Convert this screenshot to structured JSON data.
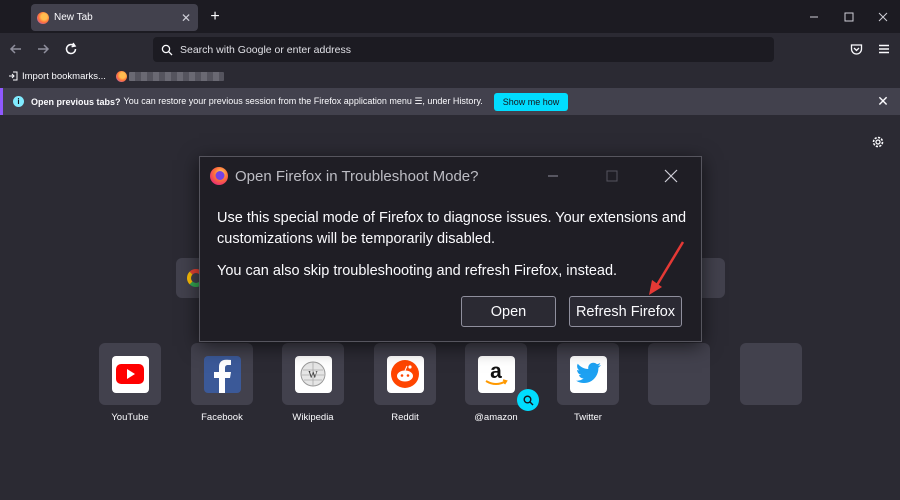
{
  "tabs": [
    {
      "title": "New Tab",
      "icon": "firefox-icon"
    }
  ],
  "window_controls": [
    "minimize-icon",
    "maximize-icon",
    "close-icon"
  ],
  "urlbar": {
    "placeholder": "Search with Google or enter address"
  },
  "bookmarks": {
    "import_label": "Import bookmarks..."
  },
  "notification": {
    "title": "Open previous tabs?",
    "message": "You can restore your previous session from the Firefox application menu ☰, under History.",
    "button": "Show me how"
  },
  "shortcuts": [
    {
      "label": "YouTube",
      "icon": "youtube-icon"
    },
    {
      "label": "Facebook",
      "icon": "facebook-icon"
    },
    {
      "label": "Wikipedia",
      "icon": "wikipedia-icon"
    },
    {
      "label": "Reddit",
      "icon": "reddit-icon"
    },
    {
      "label": "@amazon",
      "icon": "amazon-icon"
    },
    {
      "label": "Twitter",
      "icon": "twitter-icon"
    },
    {
      "label": "",
      "icon": ""
    },
    {
      "label": "",
      "icon": ""
    }
  ],
  "dialog": {
    "title": "Open Firefox in Troubleshoot Mode?",
    "paragraph1": "Use this special mode of Firefox to diagnose issues. Your extensions and customizations will be temporarily disabled.",
    "paragraph2": "You can also skip troubleshooting and refresh Firefox, instead.",
    "open_button": "Open",
    "refresh_button": "Refresh Firefox"
  },
  "colors": {
    "accent": "#00ddff",
    "notification_stripe": "#9059ff",
    "annotation_arrow": "#e53935"
  }
}
